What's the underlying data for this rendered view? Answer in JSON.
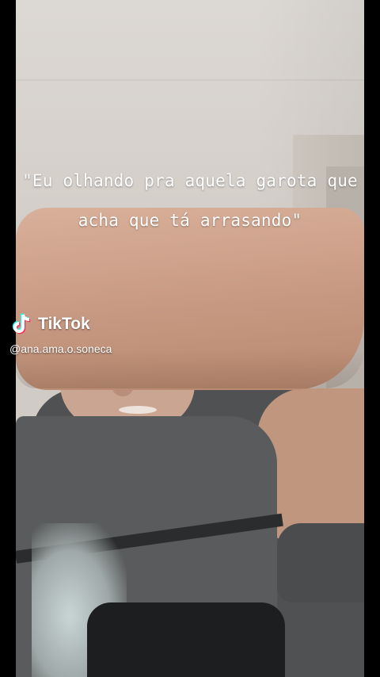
{
  "video": {
    "caption_line1": "\"Eu olhando pra aquela garota que",
    "caption_line2": "acha que tá arrasando\""
  },
  "watermark": {
    "brand": "TikTok",
    "handle": "@ana.ama.o.soneca",
    "icon": "tiktok-logo-icon"
  },
  "colors": {
    "letterbox": "#000000",
    "caption_text": "#ffffff",
    "logo_cyan": "#25f4ee",
    "logo_red": "#fe2c55"
  }
}
